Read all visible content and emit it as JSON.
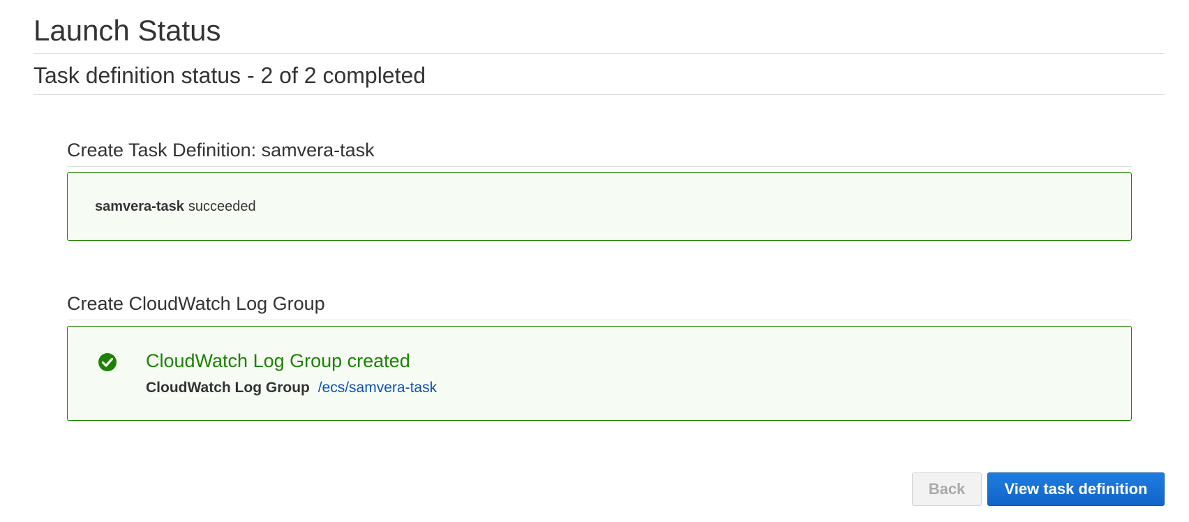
{
  "page": {
    "title": "Launch Status",
    "status_heading": "Task definition status - 2 of 2 completed"
  },
  "steps": [
    {
      "title": "Create Task Definition: samvera-task",
      "result_name": "samvera-task",
      "result_text": "succeeded"
    },
    {
      "title": "Create CloudWatch Log Group",
      "result_title": "CloudWatch Log Group created",
      "detail_label": "CloudWatch Log Group",
      "detail_link": "/ecs/samvera-task",
      "icon": "check-circle-icon"
    }
  ],
  "actions": {
    "back_label": "Back",
    "view_label": "View task definition"
  },
  "colors": {
    "success": "#1d8102",
    "link": "#0b52b8",
    "primary": "#1671d6"
  }
}
